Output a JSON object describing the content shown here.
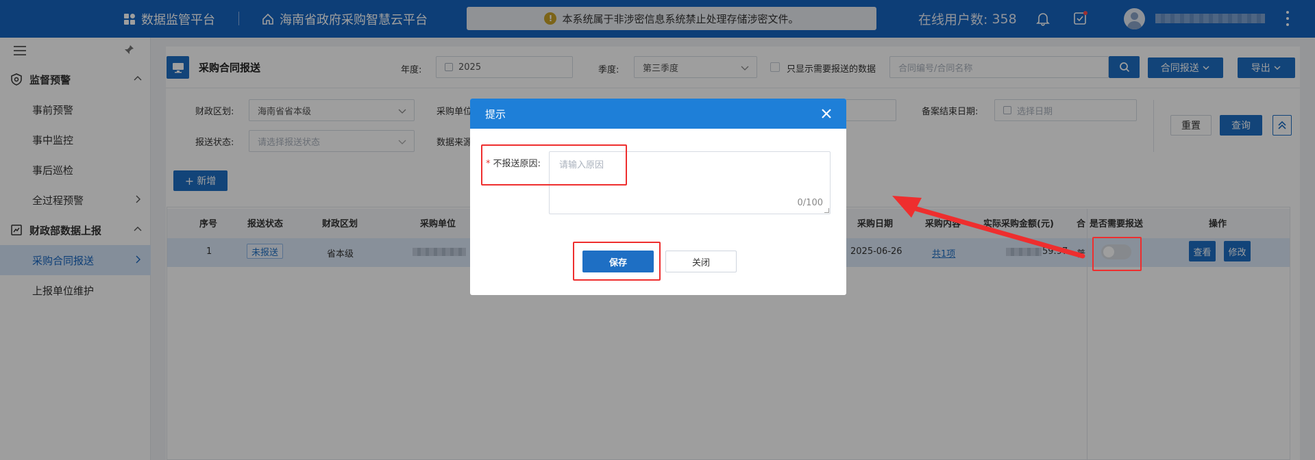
{
  "header": {
    "platform": "数据监管平台",
    "site": "海南省政府采购智慧云平台",
    "notice": "本系统属于非涉密信息系统禁止处理存储涉密文件。",
    "online_label": "在线用户数:",
    "online_count": "358"
  },
  "sidebar": {
    "groups": [
      {
        "label": "监督预警",
        "items": [
          "事前预警",
          "事中监控",
          "事后巡检",
          "全过程预警"
        ]
      },
      {
        "label": "财政部数据上报",
        "items": [
          "采购合同报送",
          "上报单位维护"
        ]
      }
    ],
    "active_item": "采购合同报送"
  },
  "page": {
    "title": "采购合同报送",
    "year_label": "年度:",
    "year_value": "2025",
    "quarter_label": "季度:",
    "quarter_value": "第三季度",
    "only_needed_label": "只显示需要报送的数据",
    "search_placeholder": "合同编号/合同名称",
    "contract_submit_btn": "合同报送",
    "export_btn": "导出",
    "region_label": "财政区划:",
    "region_value": "海南省省本级",
    "purchaser_label": "采购单位",
    "status_label": "报送状态:",
    "status_placeholder": "请选择报送状态",
    "source_label": "数据来源",
    "record_end_label": "备案结束日期:",
    "date_placeholder": "选择日期",
    "reset_btn": "重置",
    "query_btn": "查询",
    "add_btn": "新增"
  },
  "table": {
    "columns": [
      "序号",
      "报送状态",
      "财政区划",
      "采购单位",
      "采购日期",
      "采购内容",
      "实际采购金额(元)",
      "合",
      "是否需要报送",
      "操作"
    ],
    "rows": [
      {
        "index": "1",
        "status": "未报送",
        "region": "省本级",
        "date": "2025-06-26",
        "content": "共1项",
        "amount_tail": "59.97",
        "contract_tail": "普",
        "view": "查看",
        "edit": "修改"
      }
    ]
  },
  "dialog": {
    "title": "提示",
    "required_mark": "*",
    "reason_label": "不报送原因:",
    "reason_placeholder": "请输入原因",
    "counter": "0/100",
    "save_btn": "保存",
    "close_btn": "关闭"
  },
  "colors": {
    "primary": "#1565c0",
    "annotation": "#ee2e2e"
  }
}
